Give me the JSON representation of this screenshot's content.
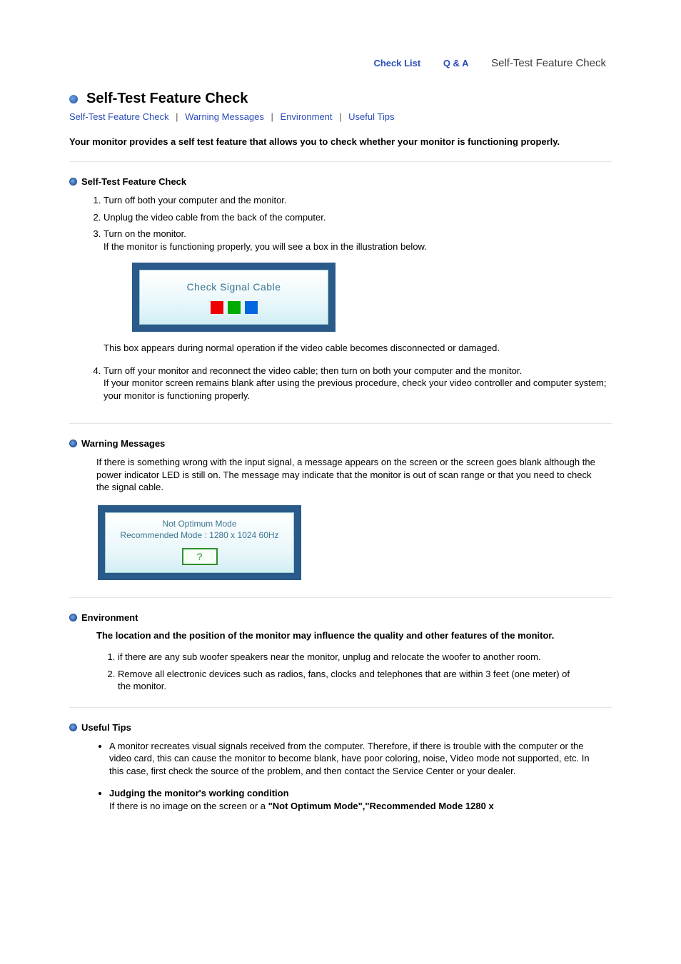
{
  "topnav": {
    "check_list": "Check List",
    "q_and_a": "Q & A",
    "self_test": "Self-Test Feature Check"
  },
  "heading": {
    "title": "Self-Test Feature Check"
  },
  "anchors": {
    "a1": "Self-Test Feature Check",
    "a2": "Warning Messages",
    "a3": "Environment",
    "a4": "Useful Tips"
  },
  "intro": "Your monitor provides a self test feature that allows you to check whether your monitor is functioning properly.",
  "selftest": {
    "subhead": "Self-Test Feature Check",
    "step1": "Turn off both your computer and the monitor.",
    "step2": "Unplug the video cable from the back of the computer.",
    "step3a": "Turn on the monitor.",
    "step3b": "If the monitor is functioning properly, you will see a box in the illustration below.",
    "ill_text": "Check Signal Cable",
    "note": "This box appears during normal operation if the video cable becomes disconnected or damaged.",
    "step4a": "Turn off your monitor and reconnect the video cable; then turn on both your computer and the monitor.",
    "step4b": "If your monitor screen remains blank after using the previous procedure, check your video controller and computer system; your monitor is functioning properly."
  },
  "warning": {
    "subhead": "Warning Messages",
    "body": "If there is something wrong with the input signal, a message appears on the screen or the screen goes blank although the power indicator LED is still on. The message may indicate that the monitor is out of scan range or that you need to check the signal cable.",
    "ill_line1": "Not Optimum Mode",
    "ill_line2": "Recommended Mode : 1280 x 1024  60Hz",
    "qmark": "?"
  },
  "environment": {
    "subhead": "Environment",
    "intro": "The location and the position of the monitor may influence the quality and other features of the monitor.",
    "item1": "if there are any sub woofer speakers near the monitor, unplug and relocate the woofer to another room.",
    "item2": "Remove all electronic devices such as radios, fans, clocks and telephones that are within 3 feet (one meter) of the monitor."
  },
  "tips": {
    "subhead": "Useful Tips",
    "tip1": "A monitor recreates visual signals received from the computer. Therefore, if there is trouble with the computer or the video card, this can cause the monitor to become blank, have poor coloring, noise, Video mode not supported, etc. In this case, first check the source of the problem, and then contact the Service Center or your dealer.",
    "tip2_title": "Judging the monitor's working condition",
    "tip2_body_a": "If there is no image on the screen or a ",
    "tip2_body_b": "\"Not Optimum Mode\",\"Recommended Mode 1280 x"
  }
}
